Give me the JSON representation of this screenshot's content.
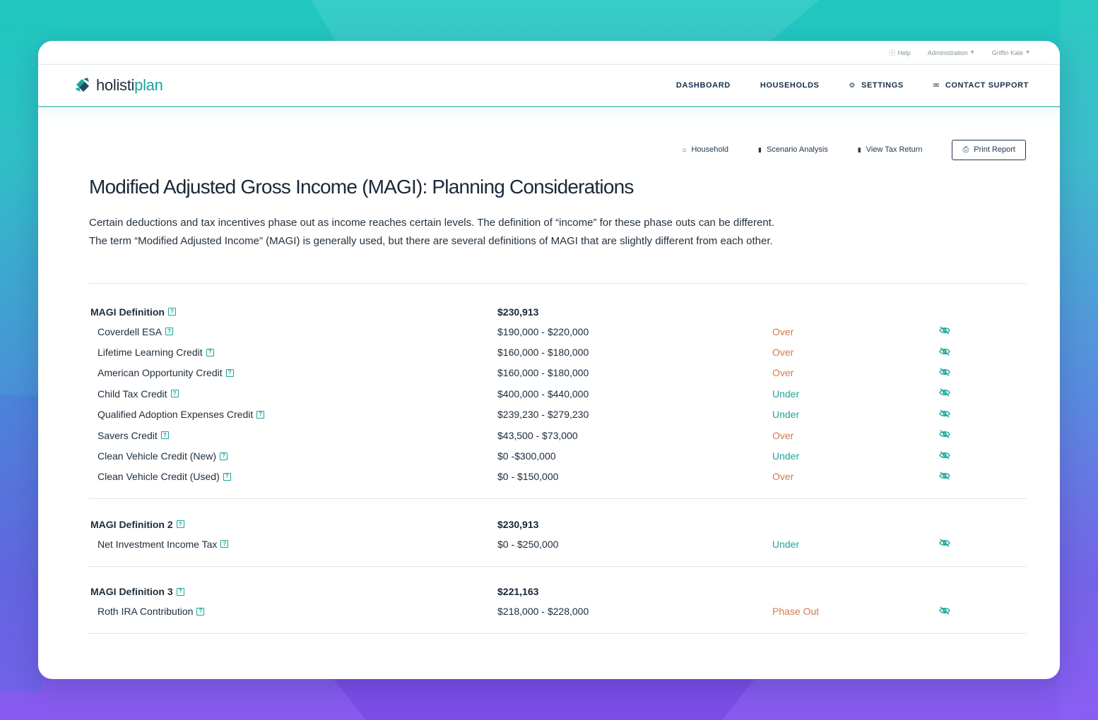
{
  "utility": {
    "help": "Help",
    "administration": "Administration",
    "user": "Griffin Kale"
  },
  "brand": {
    "logo_part1": "holisti",
    "logo_part2": "plan"
  },
  "nav": [
    {
      "label": "DASHBOARD",
      "icon": ""
    },
    {
      "label": "HOUSEHOLDS",
      "icon": ""
    },
    {
      "label": "SETTINGS",
      "icon": "gear-icon"
    },
    {
      "label": "CONTACT SUPPORT",
      "icon": "mail-icon"
    }
  ],
  "subnav": {
    "household": "Household",
    "scenario": "Scenario Analysis",
    "tax_return": "View Tax Return",
    "print": "Print Report"
  },
  "page": {
    "title": "Modified Adjusted Gross Income (MAGI): Planning Considerations",
    "desc_line1": "Certain deductions and tax incentives phase out as income reaches certain levels. The definition of “income” for these phase outs can be different.",
    "desc_line2": "The term “Modified Adjusted Income” (MAGI) is generally used, but there are several definitions of MAGI that are slightly different from each other."
  },
  "groups": [
    {
      "name": "MAGI Definition",
      "value": "$230,913",
      "items": [
        {
          "name": "Coverdell ESA",
          "range": "$190,000 - $220,000",
          "status": "Over"
        },
        {
          "name": "Lifetime Learning Credit",
          "range": "$160,000 - $180,000",
          "status": "Over"
        },
        {
          "name": "American Opportunity Credit",
          "range": "$160,000 - $180,000",
          "status": "Over"
        },
        {
          "name": "Child Tax Credit",
          "range": "$400,000 - $440,000",
          "status": "Under"
        },
        {
          "name": "Qualified Adoption Expenses Credit",
          "range": "$239,230 - $279,230",
          "status": "Under"
        },
        {
          "name": "Savers Credit",
          "range": "$43,500 - $73,000",
          "status": "Over"
        },
        {
          "name": "Clean Vehicle Credit (New)",
          "range": "$0 -$300,000",
          "status": "Under"
        },
        {
          "name": "Clean Vehicle Credit (Used)",
          "range": "$0 - $150,000",
          "status": "Over"
        }
      ]
    },
    {
      "name": "MAGI Definition 2",
      "value": "$230,913",
      "items": [
        {
          "name": "Net Investment Income Tax",
          "range": "$0 - $250,000",
          "status": "Under"
        }
      ]
    },
    {
      "name": "MAGI Definition 3",
      "value": "$221,163",
      "items": [
        {
          "name": "Roth IRA Contribution",
          "range": "$218,000 - $228,000",
          "status": "Phase Out"
        }
      ]
    }
  ],
  "colors": {
    "accent": "#1aa59a",
    "over": "#d4784e",
    "navy": "#16304a"
  }
}
